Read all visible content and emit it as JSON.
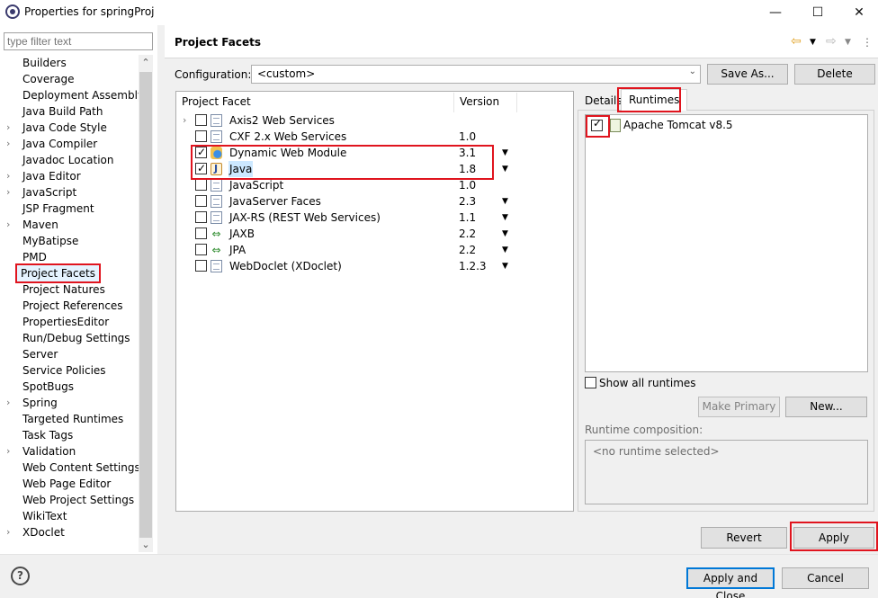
{
  "window": {
    "title": "Properties for springProj",
    "minimize": "—",
    "maximize": "☐",
    "close": "✕"
  },
  "filter": {
    "placeholder": "type filter text"
  },
  "tree": [
    {
      "label": "Builders",
      "expandable": false
    },
    {
      "label": "Coverage",
      "expandable": false
    },
    {
      "label": "Deployment Assembly",
      "expandable": false
    },
    {
      "label": "Java Build Path",
      "expandable": false
    },
    {
      "label": "Java Code Style",
      "expandable": true
    },
    {
      "label": "Java Compiler",
      "expandable": true
    },
    {
      "label": "Javadoc Location",
      "expandable": false
    },
    {
      "label": "Java Editor",
      "expandable": true
    },
    {
      "label": "JavaScript",
      "expandable": true
    },
    {
      "label": "JSP Fragment",
      "expandable": false
    },
    {
      "label": "Maven",
      "expandable": true
    },
    {
      "label": "MyBatipse",
      "expandable": false
    },
    {
      "label": "PMD",
      "expandable": false
    },
    {
      "label": "Project Facets",
      "expandable": false,
      "selected": true
    },
    {
      "label": "Project Natures",
      "expandable": false
    },
    {
      "label": "Project References",
      "expandable": false
    },
    {
      "label": "PropertiesEditor",
      "expandable": false
    },
    {
      "label": "Run/Debug Settings",
      "expandable": false
    },
    {
      "label": "Server",
      "expandable": false
    },
    {
      "label": "Service Policies",
      "expandable": false
    },
    {
      "label": "SpotBugs",
      "expandable": false
    },
    {
      "label": "Spring",
      "expandable": true
    },
    {
      "label": "Targeted Runtimes",
      "expandable": false
    },
    {
      "label": "Task Tags",
      "expandable": false
    },
    {
      "label": "Validation",
      "expandable": true
    },
    {
      "label": "Web Content Settings",
      "expandable": false
    },
    {
      "label": "Web Page Editor",
      "expandable": false
    },
    {
      "label": "Web Project Settings",
      "expandable": false
    },
    {
      "label": "WikiText",
      "expandable": false
    },
    {
      "label": "XDoclet",
      "expandable": true
    }
  ],
  "page": {
    "title": "Project Facets"
  },
  "config": {
    "label": "Configuration:",
    "value": "<custom>",
    "save_as": "Save As...",
    "delete": "Delete"
  },
  "facets_table": {
    "col_facet": "Project Facet",
    "col_version": "Version",
    "rows": [
      {
        "name": "Axis2 Web Services",
        "version": "",
        "checked": false,
        "icon": "page-icon",
        "expandable": true,
        "dropdown": false
      },
      {
        "name": "CXF 2.x Web Services",
        "version": "1.0",
        "checked": false,
        "icon": "page-icon",
        "expandable": false,
        "dropdown": false
      },
      {
        "name": "Dynamic Web Module",
        "version": "3.1",
        "checked": true,
        "icon": "web-module-icon",
        "expandable": false,
        "dropdown": true
      },
      {
        "name": "Java",
        "version": "1.8",
        "checked": true,
        "icon": "java-icon",
        "expandable": false,
        "dropdown": true,
        "highlight": true
      },
      {
        "name": "JavaScript",
        "version": "1.0",
        "checked": false,
        "icon": "page-icon",
        "expandable": false,
        "dropdown": false
      },
      {
        "name": "JavaServer Faces",
        "version": "2.3",
        "checked": false,
        "icon": "page-icon",
        "expandable": false,
        "dropdown": true
      },
      {
        "name": "JAX-RS (REST Web Services)",
        "version": "1.1",
        "checked": false,
        "icon": "page-icon",
        "expandable": false,
        "dropdown": true
      },
      {
        "name": "JAXB",
        "version": "2.2",
        "checked": false,
        "icon": "jaxb-icon",
        "expandable": false,
        "dropdown": true
      },
      {
        "name": "JPA",
        "version": "2.2",
        "checked": false,
        "icon": "jaxb-icon",
        "expandable": false,
        "dropdown": true
      },
      {
        "name": "WebDoclet (XDoclet)",
        "version": "1.2.3",
        "checked": false,
        "icon": "page-icon",
        "expandable": false,
        "dropdown": true
      }
    ]
  },
  "tabs": {
    "details": "Details",
    "runtimes": "Runtimes"
  },
  "runtimes": {
    "items": [
      {
        "name": "Apache Tomcat v8.5",
        "checked": true
      }
    ],
    "show_all": "Show all runtimes",
    "make_primary": "Make Primary",
    "new": "New...",
    "composition_label": "Runtime composition:",
    "composition_value": "<no runtime selected>"
  },
  "actions": {
    "revert": "Revert",
    "apply": "Apply",
    "apply_close": "Apply and Close",
    "cancel": "Cancel",
    "help": "?"
  },
  "colors": {
    "highlight_red": "#e0141e",
    "focus_blue": "#0078d7",
    "selection": "#cce8ff"
  }
}
